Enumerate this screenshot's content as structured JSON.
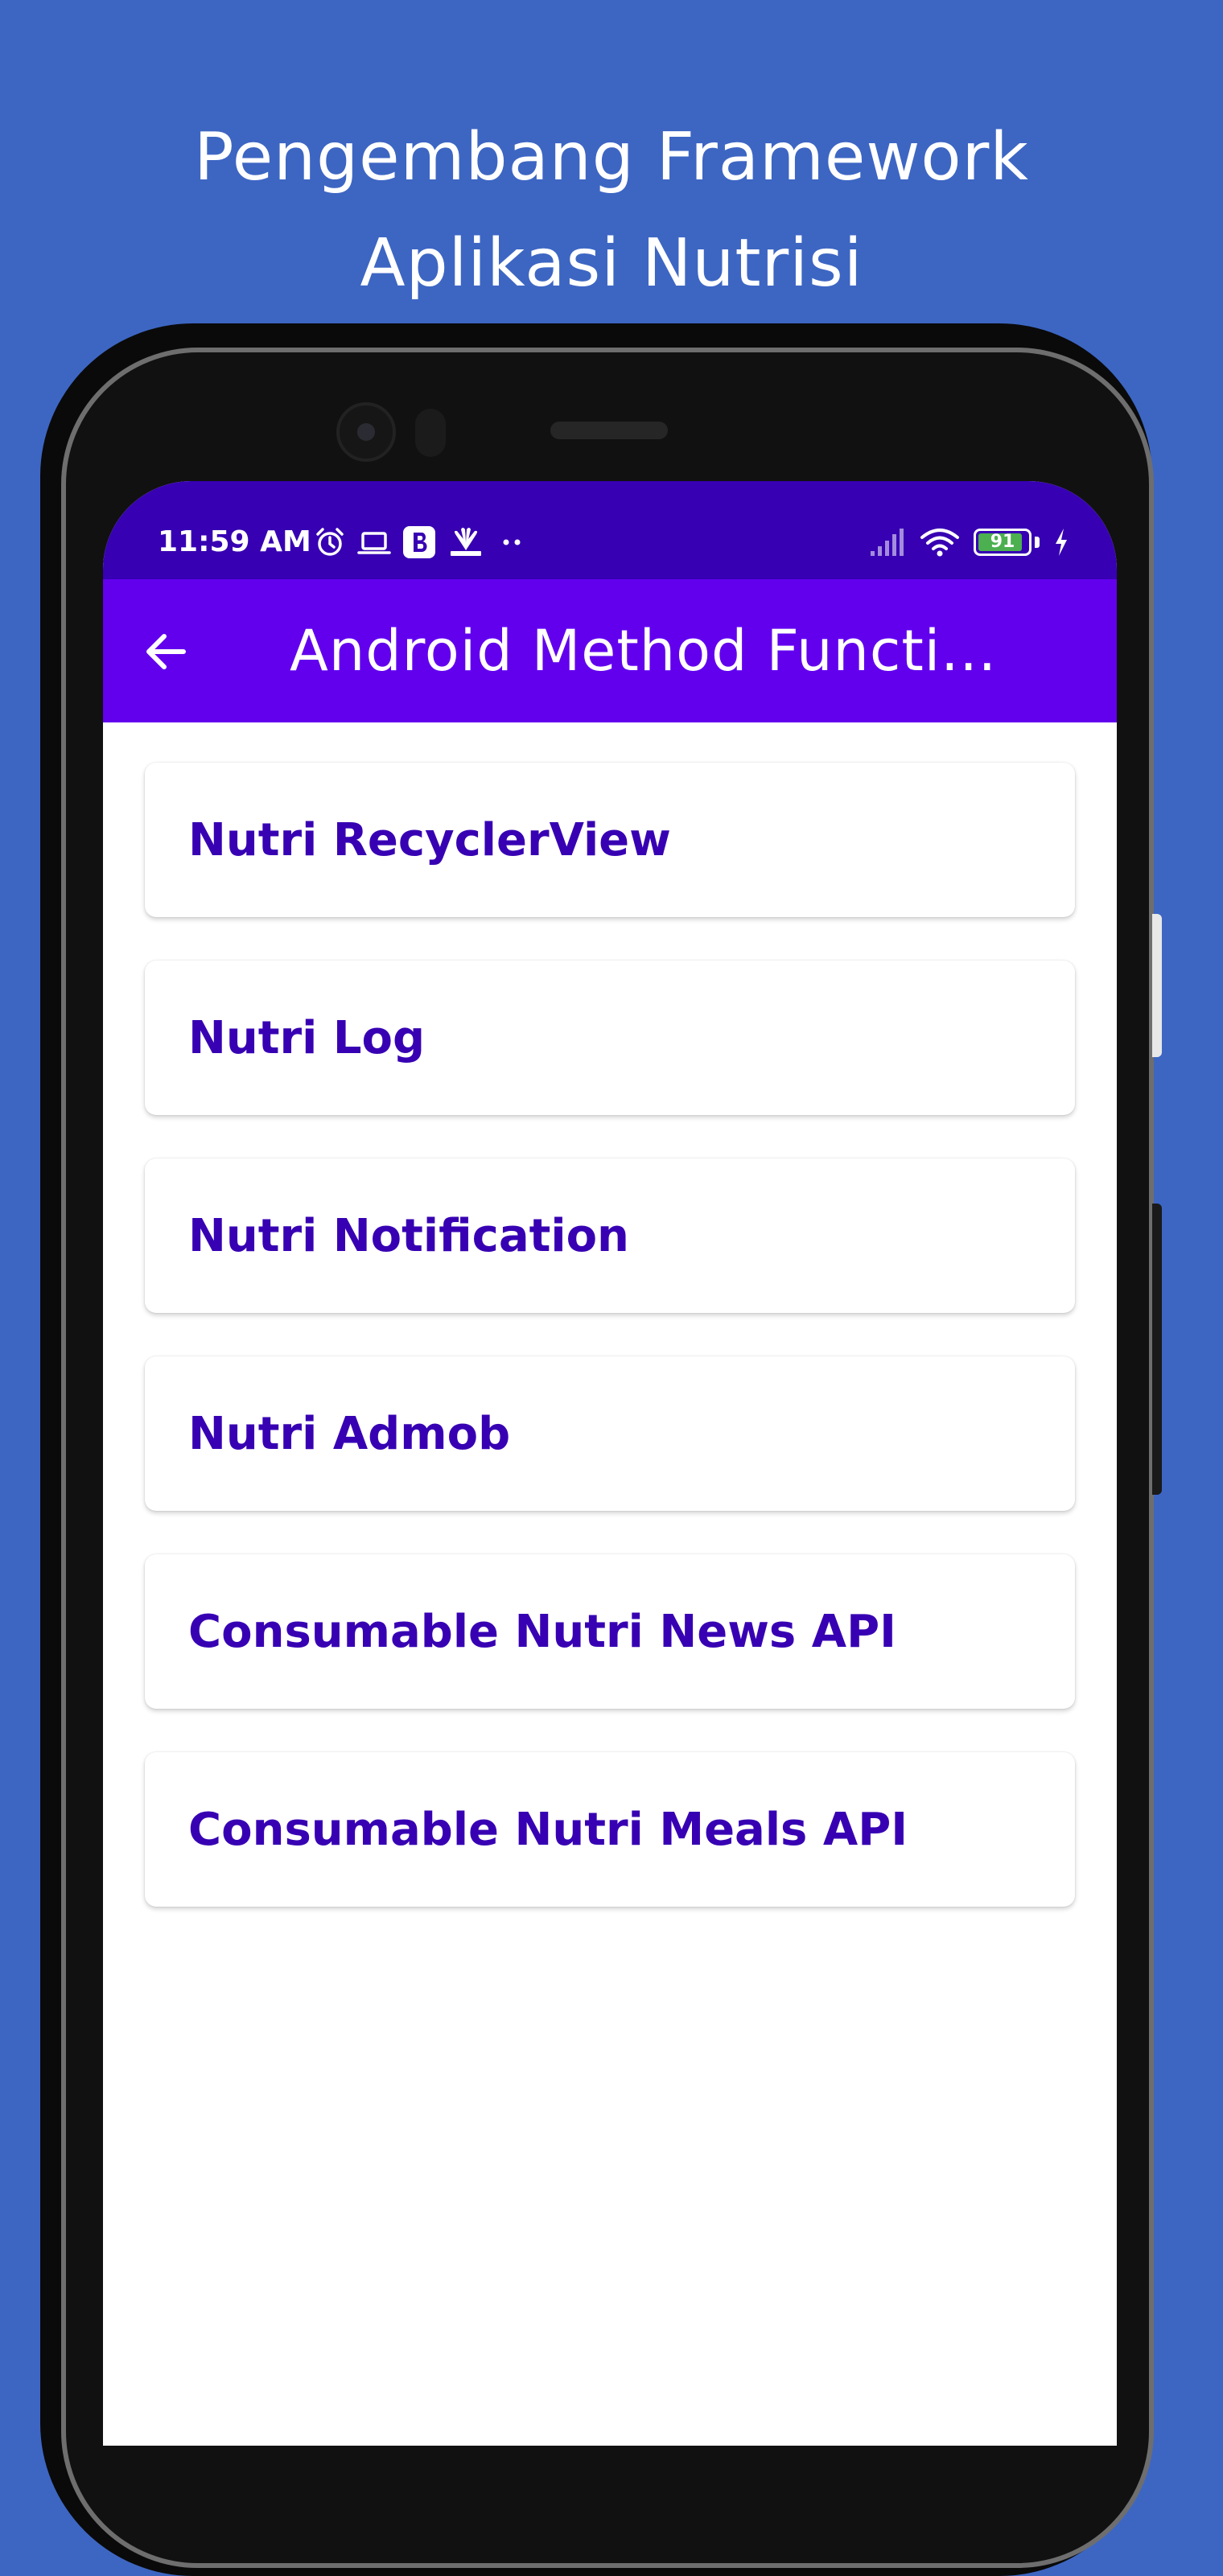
{
  "promo": {
    "line1": "Pengembang Framework",
    "line2": "Aplikasi Nutrisi"
  },
  "status_bar": {
    "time": "11:59 AM",
    "battery_level": "91",
    "left_icons": [
      "alarm-icon",
      "laptop-icon",
      "b-app-icon",
      "cnbc-icon",
      "more-dots-icon"
    ],
    "right_icons": [
      "signal-icon",
      "wifi-icon",
      "battery-icon",
      "charging-icon"
    ]
  },
  "app_bar": {
    "title": "Android Method Functi...",
    "back_icon": "arrow-left-icon"
  },
  "menu": {
    "items": [
      {
        "label": "Nutri RecyclerView"
      },
      {
        "label": "Nutri Log"
      },
      {
        "label": "Nutri Notification"
      },
      {
        "label": "Nutri Admob"
      },
      {
        "label": "Consumable Nutri News API"
      },
      {
        "label": "Consumable Nutri Meals API"
      }
    ]
  },
  "colors": {
    "page_background": "#3d66c3",
    "status_bar": "#3700b3",
    "app_bar": "#6200ee",
    "card_text": "#3700b3",
    "battery_fill": "#4caf50"
  }
}
